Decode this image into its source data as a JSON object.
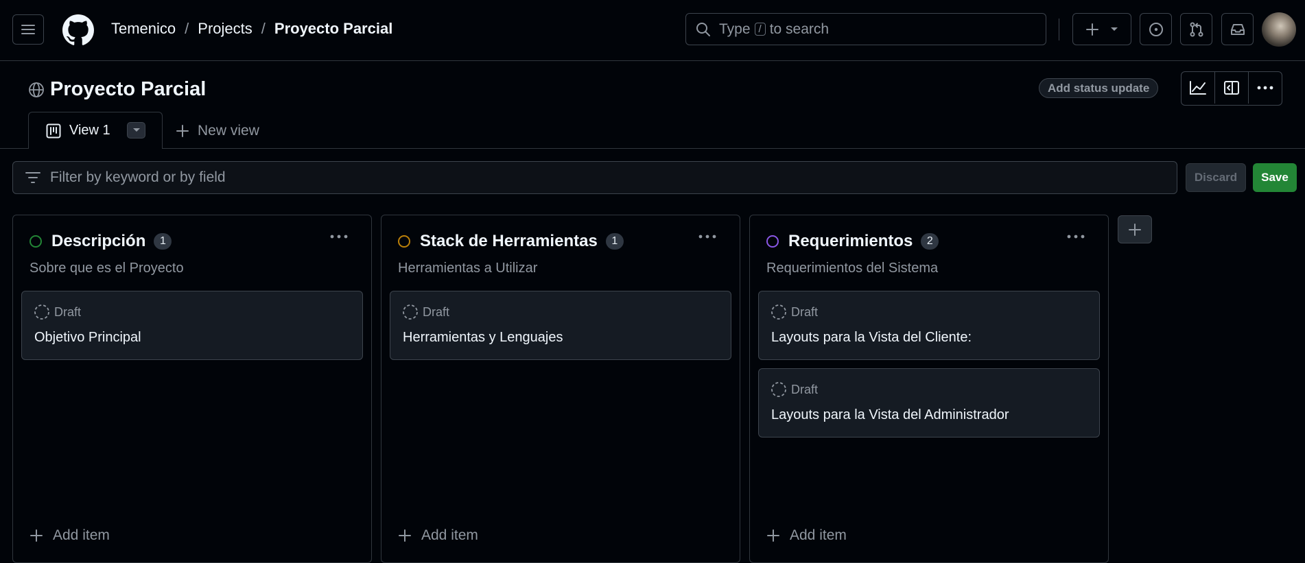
{
  "header": {
    "breadcrumb": [
      "Temenico",
      "Projects",
      "Proyecto Parcial"
    ],
    "search": {
      "prefix": "Type",
      "key": "/",
      "suffix": "to search"
    }
  },
  "project": {
    "title": "Proyecto Parcial",
    "status_update_label": "Add status update"
  },
  "tabs": {
    "active_label": "View 1",
    "new_view_label": "New view"
  },
  "filter": {
    "placeholder": "Filter by keyword or by field",
    "discard_label": "Discard",
    "save_label": "Save"
  },
  "colors": {
    "accent_green": "#238636",
    "status_green": "#238636",
    "status_orange": "#bb8009",
    "status_purple": "#8957e5"
  },
  "columns": [
    {
      "title": "Descripción",
      "count": "1",
      "description": "Sobre que es el Proyecto",
      "status_color": "#238636",
      "cards": [
        {
          "status": "Draft",
          "title": "Objetivo Principal"
        }
      ],
      "add_item_label": "Add item"
    },
    {
      "title": "Stack de Herramientas",
      "count": "1",
      "description": "Herramientas a Utilizar",
      "status_color": "#bb8009",
      "cards": [
        {
          "status": "Draft",
          "title": "Herramientas y Lenguajes"
        }
      ],
      "add_item_label": "Add item"
    },
    {
      "title": "Requerimientos",
      "count": "2",
      "description": "Requerimientos del Sistema",
      "status_color": "#8957e5",
      "cards": [
        {
          "status": "Draft",
          "title": "Layouts para la Vista del Cliente:"
        },
        {
          "status": "Draft",
          "title": "Layouts para la Vista del Administrador"
        }
      ],
      "add_item_label": "Add item"
    }
  ]
}
